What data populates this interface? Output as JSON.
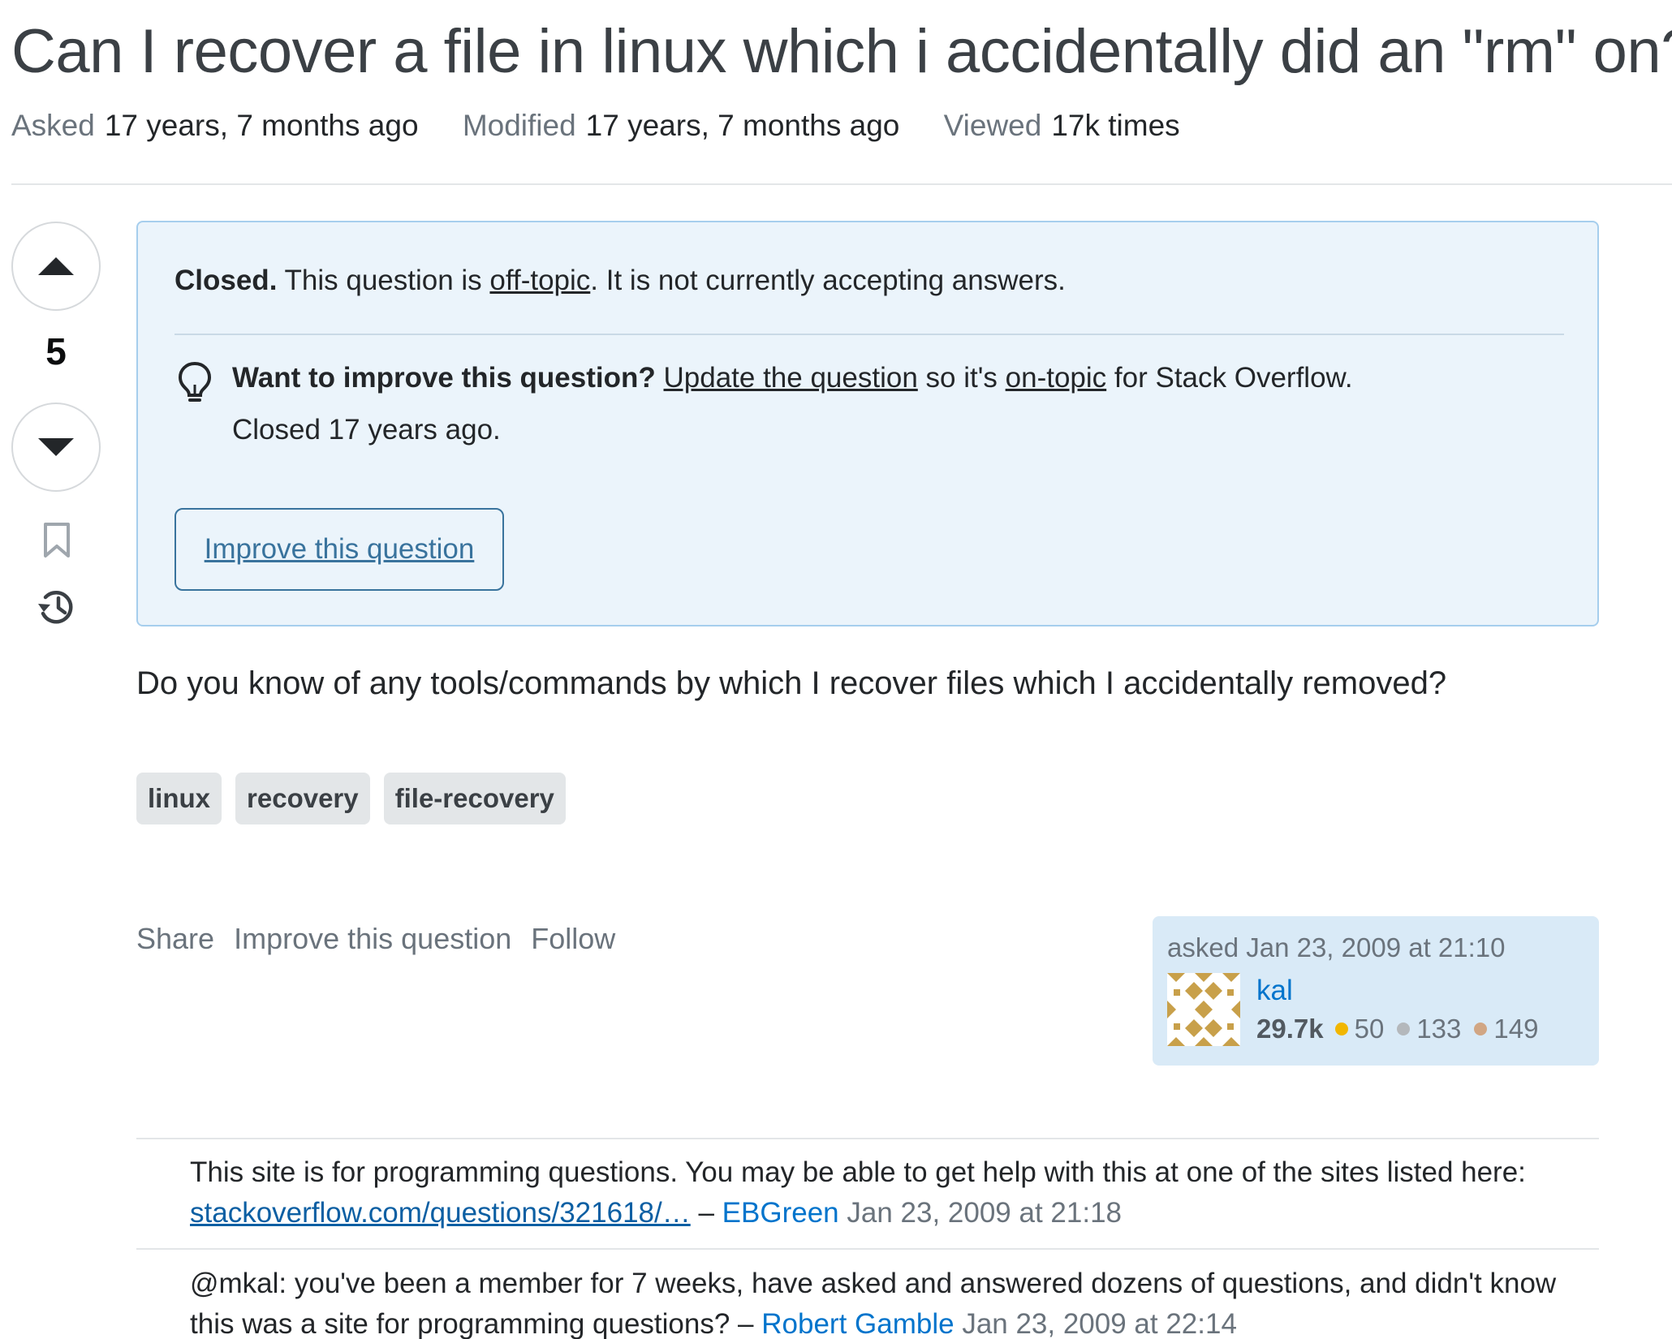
{
  "question": {
    "title": "Can I recover a file in linux which i accidentally did an \"rm\" on?",
    "meta": {
      "asked_label": "Asked",
      "asked_value": "17 years, 7 months ago",
      "modified_label": "Modified",
      "modified_value": "17 years, 7 months ago",
      "viewed_label": "Viewed",
      "viewed_value": "17k times"
    },
    "vote_count": "5",
    "body": "Do you know of any tools/commands by which I recover files which I accidentally removed?",
    "tags": [
      "linux",
      "recovery",
      "file-recovery"
    ]
  },
  "notice": {
    "closed_bold": "Closed.",
    "closed_text_1": "This question is",
    "closed_link": "off-topic",
    "closed_text_2": ". It is not currently accepting answers.",
    "improve_bold": "Want to improve this question?",
    "update_link": "Update the question",
    "so_its": "so it's",
    "on_topic_link": "on-topic",
    "for_so": "for Stack Overflow.",
    "closed_ago": "Closed 17 years ago.",
    "improve_button": "Improve this question"
  },
  "post_menu": {
    "share": "Share",
    "improve": "Improve this question",
    "follow": "Follow"
  },
  "owner": {
    "asked_label": "asked Jan 23, 2009 at 21:10",
    "name": "kal",
    "reputation": "29.7k",
    "gold": "50",
    "silver": "133",
    "bronze": "149",
    "colors": {
      "gold": "#f1b600",
      "silver": "#9a9ea2",
      "bronze": "#ab825f"
    }
  },
  "comments": [
    {
      "text": "This site is for programming questions. You may be able to get help with this at one of the sites listed here:",
      "link": "stackoverflow.com/questions/321618/…",
      "dash": "–",
      "user": "EBGreen",
      "date": "Jan 23, 2009 at 21:18"
    },
    {
      "text": "@mkal: you've been a member for 7 weeks, have asked and answered dozens of questions, and didn't know this was a site for programming questions?",
      "dash": "–",
      "user": "Robert Gamble",
      "date": "Jan 23, 2009 at 22:14"
    }
  ],
  "icons": {
    "upvote": "arrow-up-icon",
    "downvote": "arrow-down-icon",
    "bookmark": "bookmark-icon",
    "history": "history-icon",
    "lightbulb": "lightbulb-icon"
  }
}
